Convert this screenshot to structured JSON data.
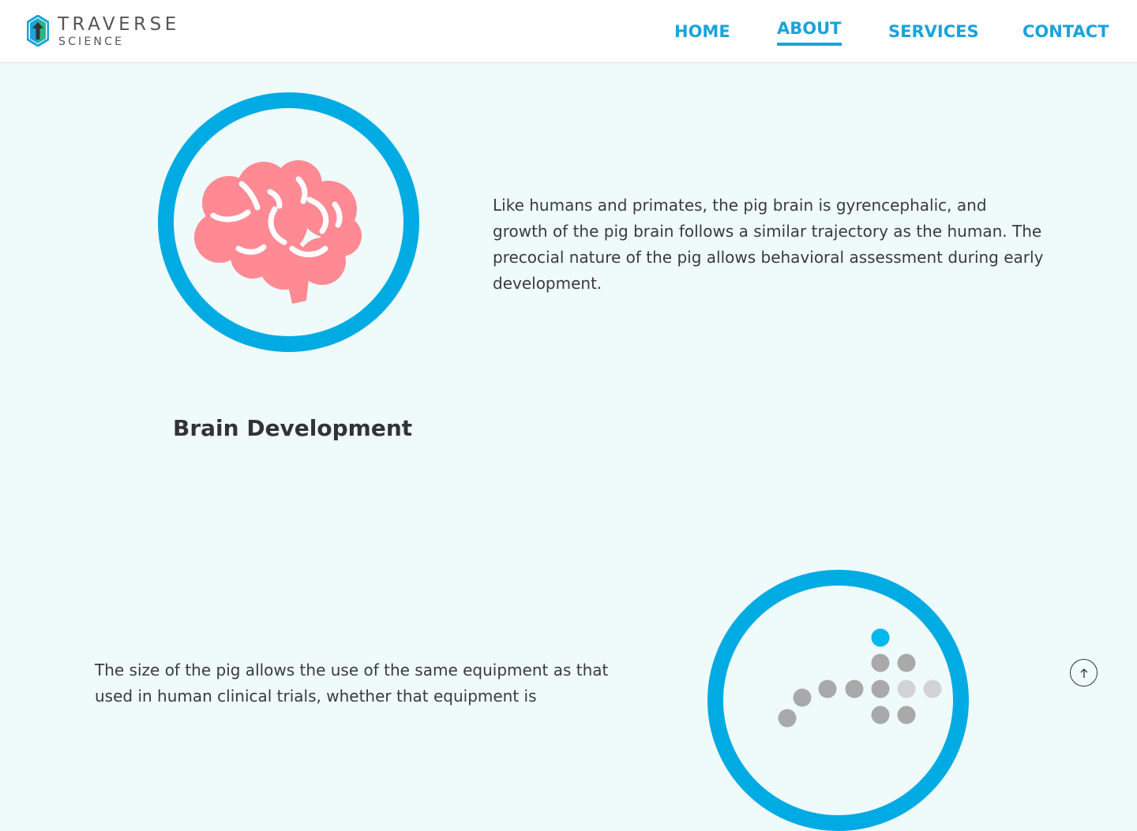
{
  "brand": {
    "name": "TRAVERSE",
    "tagline": "SCIENCE"
  },
  "nav": {
    "items": [
      {
        "label": "HOME",
        "active": false
      },
      {
        "label": "ABOUT",
        "active": true
      },
      {
        "label": "SERVICES",
        "active": false
      },
      {
        "label": "CONTACT",
        "active": false
      }
    ]
  },
  "sections": [
    {
      "icon": "brain-icon",
      "title": "Brain Development",
      "text": "Like humans and primates, the pig brain is gyrencephalic, and growth of the pig brain follows a similar trajectory as the human. The precocial nature of the pig allows behavioral assessment during early development."
    },
    {
      "icon": "dot-matrix-icon",
      "text": "The size of the pig allows the use of the same equipment as that used in human clinical trials, whether that equipment is"
    }
  ],
  "scroll_top": {
    "icon": "arrow-up-icon"
  },
  "colors": {
    "accent": "#00abe3",
    "nav_text": "#1aa3dc",
    "page_background": "#effafb",
    "brain": "#ff8a93",
    "dot_gray": "#a9a9a9",
    "dot_light_gray": "#d3d3d3",
    "dot_highlight": "#00b8ec"
  }
}
